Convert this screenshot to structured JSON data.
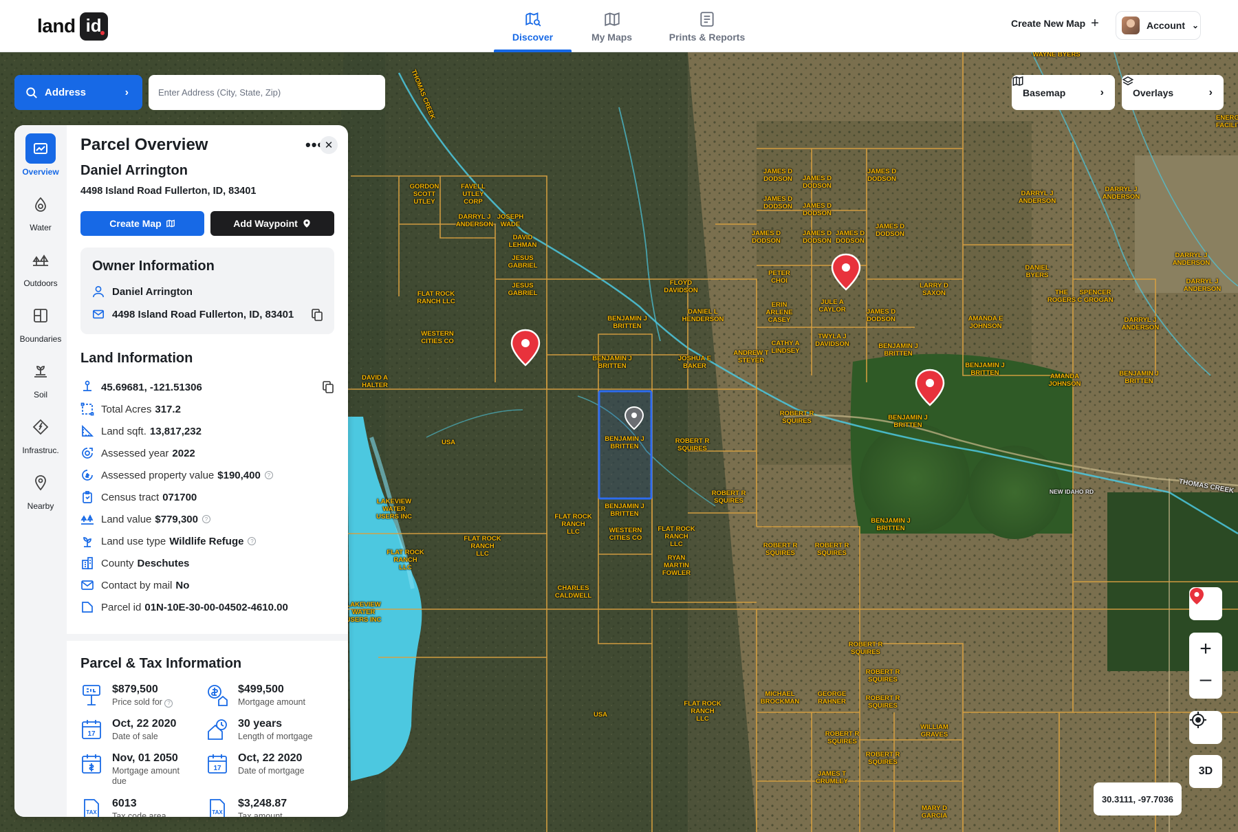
{
  "app": {
    "logo_word": "land",
    "logo_badge": "id"
  },
  "nav": {
    "tabs": [
      {
        "label": "Discover",
        "icon": "discover-map-icon",
        "active": true
      },
      {
        "label": "My Maps",
        "icon": "map-icon",
        "active": false
      },
      {
        "label": "Prints & Reports",
        "icon": "report-icon",
        "active": false
      }
    ],
    "create_new_map": "Create New Map",
    "account": "Account"
  },
  "search": {
    "mode_label": "Address",
    "placeholder": "Enter Address (City, State, Zip)"
  },
  "map_controls": {
    "basemap": "Basemap",
    "overlays": "Overlays",
    "three_d": "3D",
    "help": "?",
    "coordinates": "30.3111, -97.7036"
  },
  "map_labels": [
    "Wayne Byers",
    "Thomas Creek",
    "Gordon Scott Utley",
    "Favell Utley Corp",
    "Darryl J Anderson",
    "Joseph Wade",
    "David Lehman",
    "Jesus Gabriel",
    "Flat Rock Ranch LLC",
    "Western Cities Co",
    "David A Halter",
    "USA",
    "Benjamin J Britten",
    "Floyd Davidson",
    "Daniel L Henderson",
    "Joshua E Baker",
    "Andrew T Steyer",
    "Cathy A Lindsey",
    "Twyla J Davidson",
    "James D Dodson",
    "Peter Choi",
    "Erin Arlene Casey",
    "Jule A Caylor",
    "Larry D Saxon",
    "Daniel Byers",
    "The Rogers",
    "Spencer C Grogan",
    "Amanda E Johnson",
    "Darryl J Anderson",
    "Robert R Squires",
    "Amanda Johnson",
    "Lakeview Water Users Inc",
    "Charles Caldwell",
    "Ryan Martin Fowler",
    "Michael Brockman",
    "George Rahner",
    "William Graves",
    "James T Crumley",
    "Mary D Garcia",
    "New Idaho Rd",
    "Thomas Creek",
    "Energy Facility"
  ],
  "rail": [
    {
      "label": "Overview",
      "icon": "overview-icon",
      "active": true
    },
    {
      "label": "Water",
      "icon": "water-drop-icon",
      "active": false
    },
    {
      "label": "Outdoors",
      "icon": "trees-icon",
      "active": false
    },
    {
      "label": "Boundaries",
      "icon": "boundaries-icon",
      "active": false
    },
    {
      "label": "Soil",
      "icon": "soil-plant-icon",
      "active": false
    },
    {
      "label": "Infrastruc.",
      "icon": "infrastructure-icon",
      "active": false
    },
    {
      "label": "Nearby",
      "icon": "location-pin-icon",
      "active": false
    }
  ],
  "panel": {
    "title": "Parcel Overview",
    "owner_name": "Daniel Arrington",
    "address": "4498 Island Road Fullerton, ID, 83401",
    "create_map": "Create Map",
    "add_waypoint": "Add Waypoint",
    "owner_info": {
      "heading": "Owner Information",
      "name": "Daniel Arrington",
      "address": "4498 Island Road Fullerton, ID, 83401"
    },
    "land_info": {
      "heading": "Land Information",
      "coordinates": "45.69681, -121.51306",
      "rows": [
        {
          "label": "Total Acres",
          "value": "317.2"
        },
        {
          "label": "Land sqft.",
          "value": "13,817,232"
        },
        {
          "label": "Assessed year",
          "value": "2022"
        },
        {
          "label": "Assessed property value",
          "value": "$190,400"
        },
        {
          "label": "Census tract",
          "value": "071700"
        },
        {
          "label": "Land value",
          "value": "$779,300"
        },
        {
          "label": "Land use type",
          "value": "Wildlife Refuge"
        },
        {
          "label": "County",
          "value": "Deschutes"
        },
        {
          "label": "Contact by mail",
          "value": "No"
        },
        {
          "label": "Parcel id",
          "value": "01N-10E-30-00-04502-4610.00"
        }
      ]
    },
    "tax_info": {
      "heading": "Parcel & Tax Information",
      "items": [
        {
          "value": "$879,500",
          "label": "Price sold for"
        },
        {
          "value": "$499,500",
          "label": "Mortgage amount"
        },
        {
          "value": "Oct, 22 2020",
          "label": "Date of sale"
        },
        {
          "value": "30 years",
          "label": "Length of mortgage"
        },
        {
          "value": "Nov, 01 2050",
          "label": "Mortgage amount due"
        },
        {
          "value": "Oct, 22 2020",
          "label": "Date of mortgage"
        },
        {
          "value": "6013",
          "label": "Tax code area"
        },
        {
          "value": "$3,248.87",
          "label": "Tax amount"
        }
      ]
    }
  },
  "colors": {
    "accent": "#1769e6",
    "parcel_line": "#d8a040",
    "owner_text": "#f5b400",
    "pin": "#e8323c",
    "water": "#4cc8e0"
  }
}
